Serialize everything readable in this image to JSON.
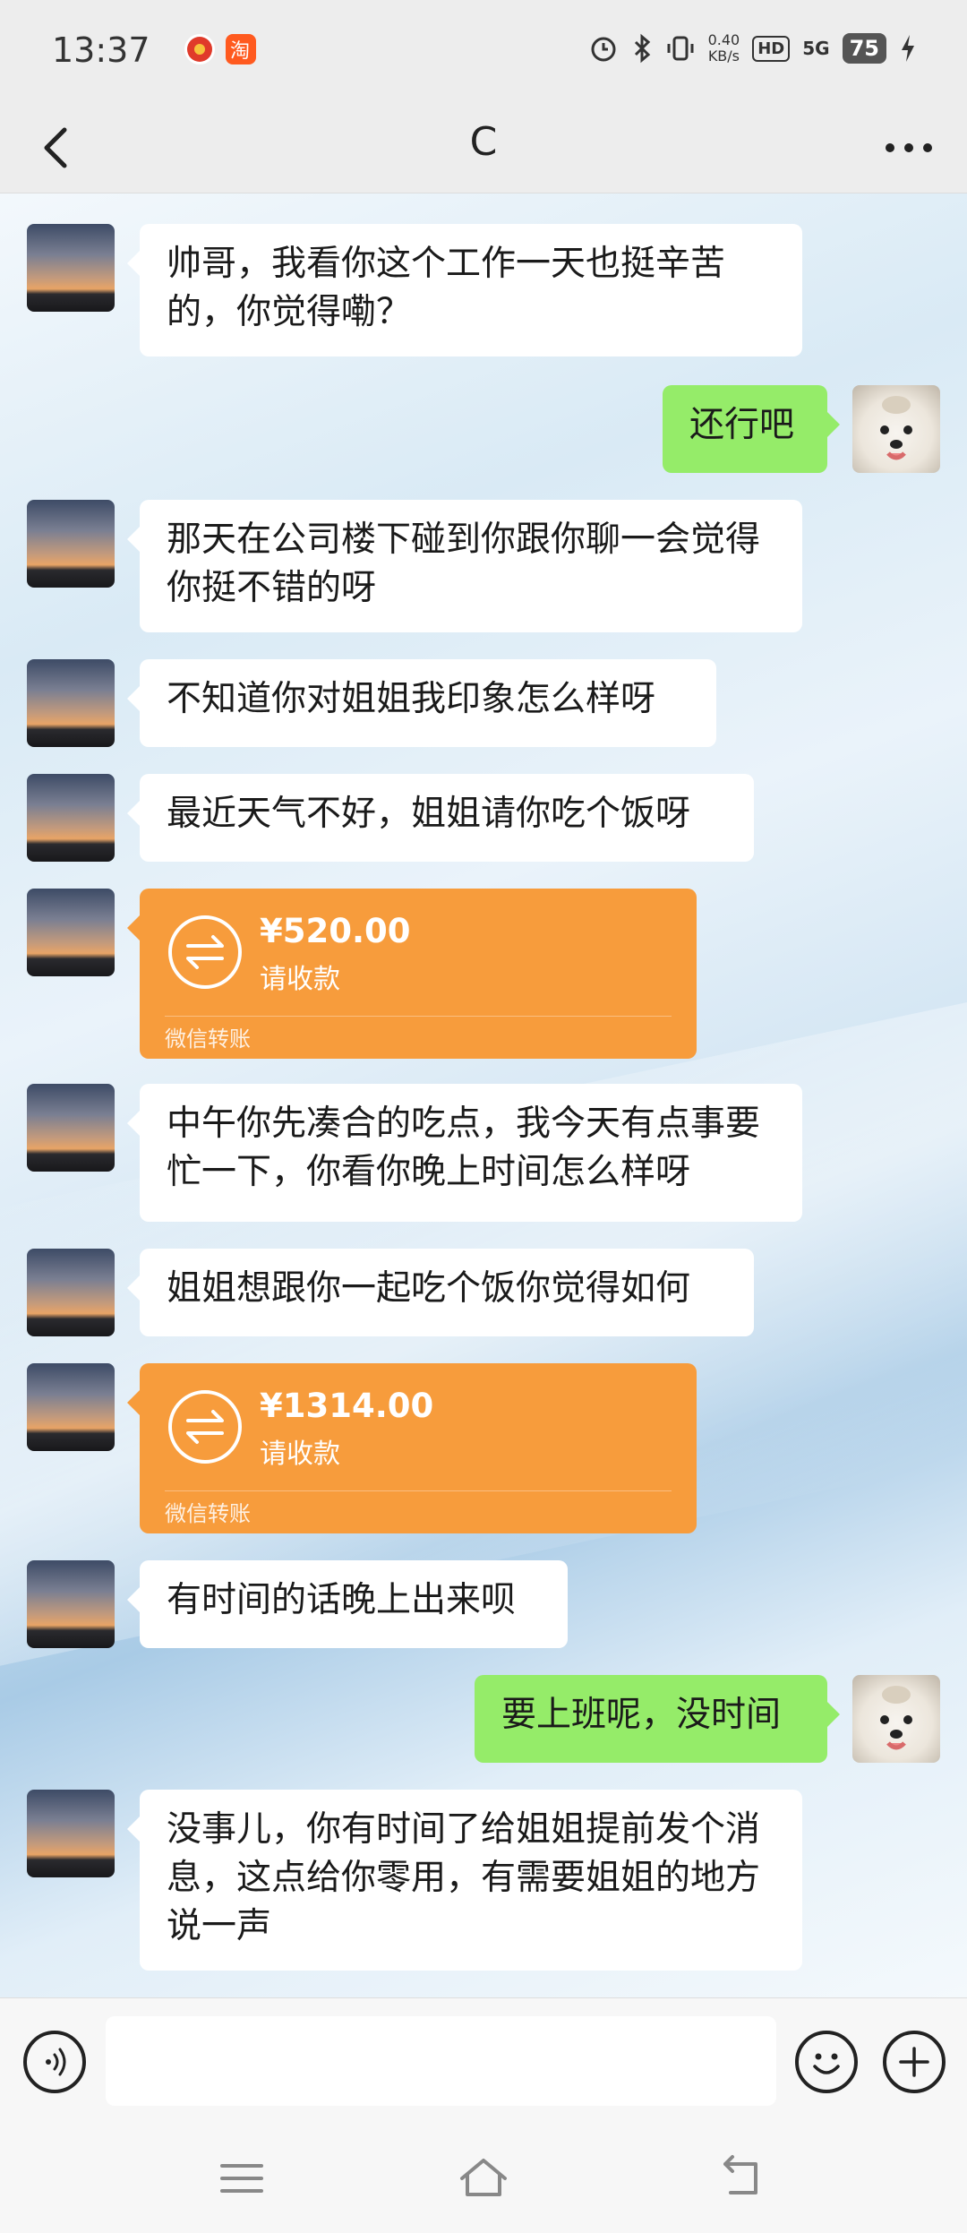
{
  "status_bar": {
    "time": "13:37",
    "network_speed_value": "0.40",
    "network_speed_unit": "KB/s",
    "hd_label": "HD",
    "signal_label": "5G",
    "battery": "75",
    "icons": [
      "app-badge-icon",
      "taobao-icon",
      "alarm-icon",
      "bluetooth-icon",
      "vibrate-icon",
      "charging-icon"
    ]
  },
  "header": {
    "title": "C"
  },
  "messages": [
    {
      "side": "left",
      "text": "帅哥，我看你这个工作一天也挺辛苦的，你觉得嘞？"
    },
    {
      "side": "right",
      "text": "还行吧"
    },
    {
      "side": "left",
      "text": "那天在公司楼下碰到你跟你聊一会觉得你挺不错的呀"
    },
    {
      "side": "left",
      "text": "不知道你对姐姐我印象怎么样呀"
    },
    {
      "side": "left",
      "text": "最近天气不好，姐姐请你吃个饭呀"
    },
    {
      "side": "left",
      "type": "transfer",
      "amount": "¥520.00",
      "status": "请收款",
      "brand": "微信转账"
    },
    {
      "side": "left",
      "text": "中午你先凑合的吃点，我今天有点事要忙一下，你看你晚上时间怎么样呀"
    },
    {
      "side": "left",
      "text": "姐姐想跟你一起吃个饭你觉得如何"
    },
    {
      "side": "left",
      "type": "transfer",
      "amount": "¥1314.00",
      "status": "请收款",
      "brand": "微信转账"
    },
    {
      "side": "left",
      "text": "有时间的话晚上出来呗"
    },
    {
      "side": "right",
      "text": "要上班呢，没时间"
    },
    {
      "side": "left",
      "text": "没事儿，你有时间了给姐姐提前发个消息，这点给你零用，有需要姐姐的地方说一声"
    }
  ],
  "input": {
    "value": "",
    "placeholder": ""
  },
  "colors": {
    "sent_bubble": "#95ec69",
    "received_bubble": "#ffffff",
    "transfer": "#f79c3c"
  }
}
